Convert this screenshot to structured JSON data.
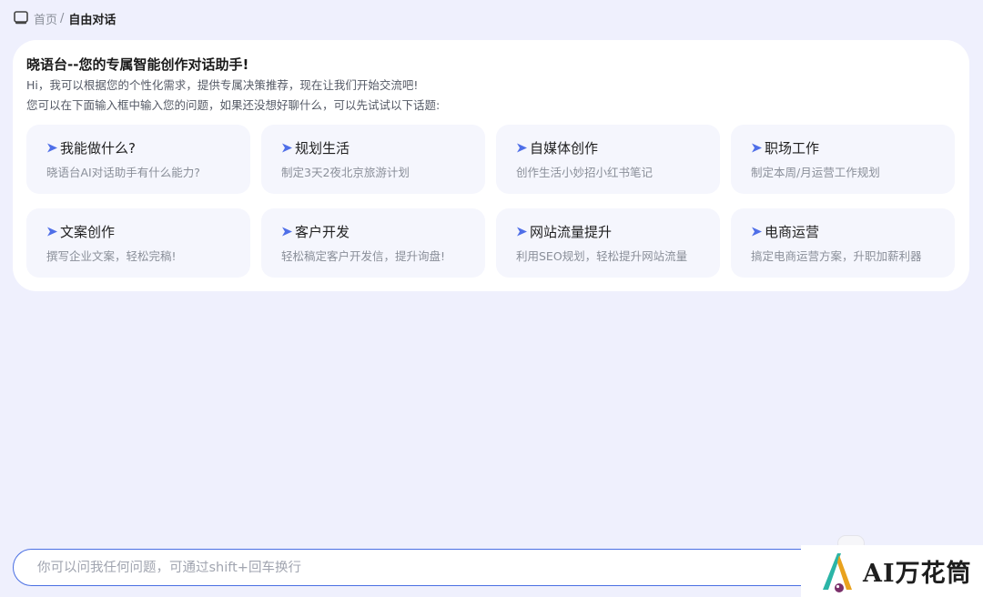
{
  "breadcrumb": {
    "icon": "monitor-icon",
    "home": "首页",
    "separator": "/",
    "current": "自由对话"
  },
  "welcome": {
    "title": "晓语台--您的专属智能创作对话助手!",
    "line1": "Hi，我可以根据您的个性化需求，提供专属决策推荐，现在让我们开始交流吧!",
    "line2": "您可以在下面输入框中输入您的问题，如果还没想好聊什么，可以先试试以下话题:"
  },
  "topics": [
    {
      "title": "我能做什么?",
      "desc": "晓语台AI对话助手有什么能力?"
    },
    {
      "title": "规划生活",
      "desc": "制定3天2夜北京旅游计划"
    },
    {
      "title": "自媒体创作",
      "desc": "创作生活小妙招小红书笔记"
    },
    {
      "title": "职场工作",
      "desc": "制定本周/月运营工作规划"
    },
    {
      "title": "文案创作",
      "desc": "撰写企业文案，轻松完稿!"
    },
    {
      "title": "客户开发",
      "desc": "轻松稿定客户开发信，提升询盘!"
    },
    {
      "title": "网站流量提升",
      "desc": "利用SEO规划，轻松提升网站流量"
    },
    {
      "title": "电商运营",
      "desc": "搞定电商运营方案，升职加薪利器"
    }
  ],
  "input": {
    "placeholder": "你可以问我任何问题，可通过shift+回车换行"
  },
  "watermark": {
    "text": "AI万花筒"
  },
  "colors": {
    "background": "#eff0fd",
    "accent": "#4a6fe3",
    "card": "#ffffff",
    "topic_card": "#f5f6fd"
  }
}
